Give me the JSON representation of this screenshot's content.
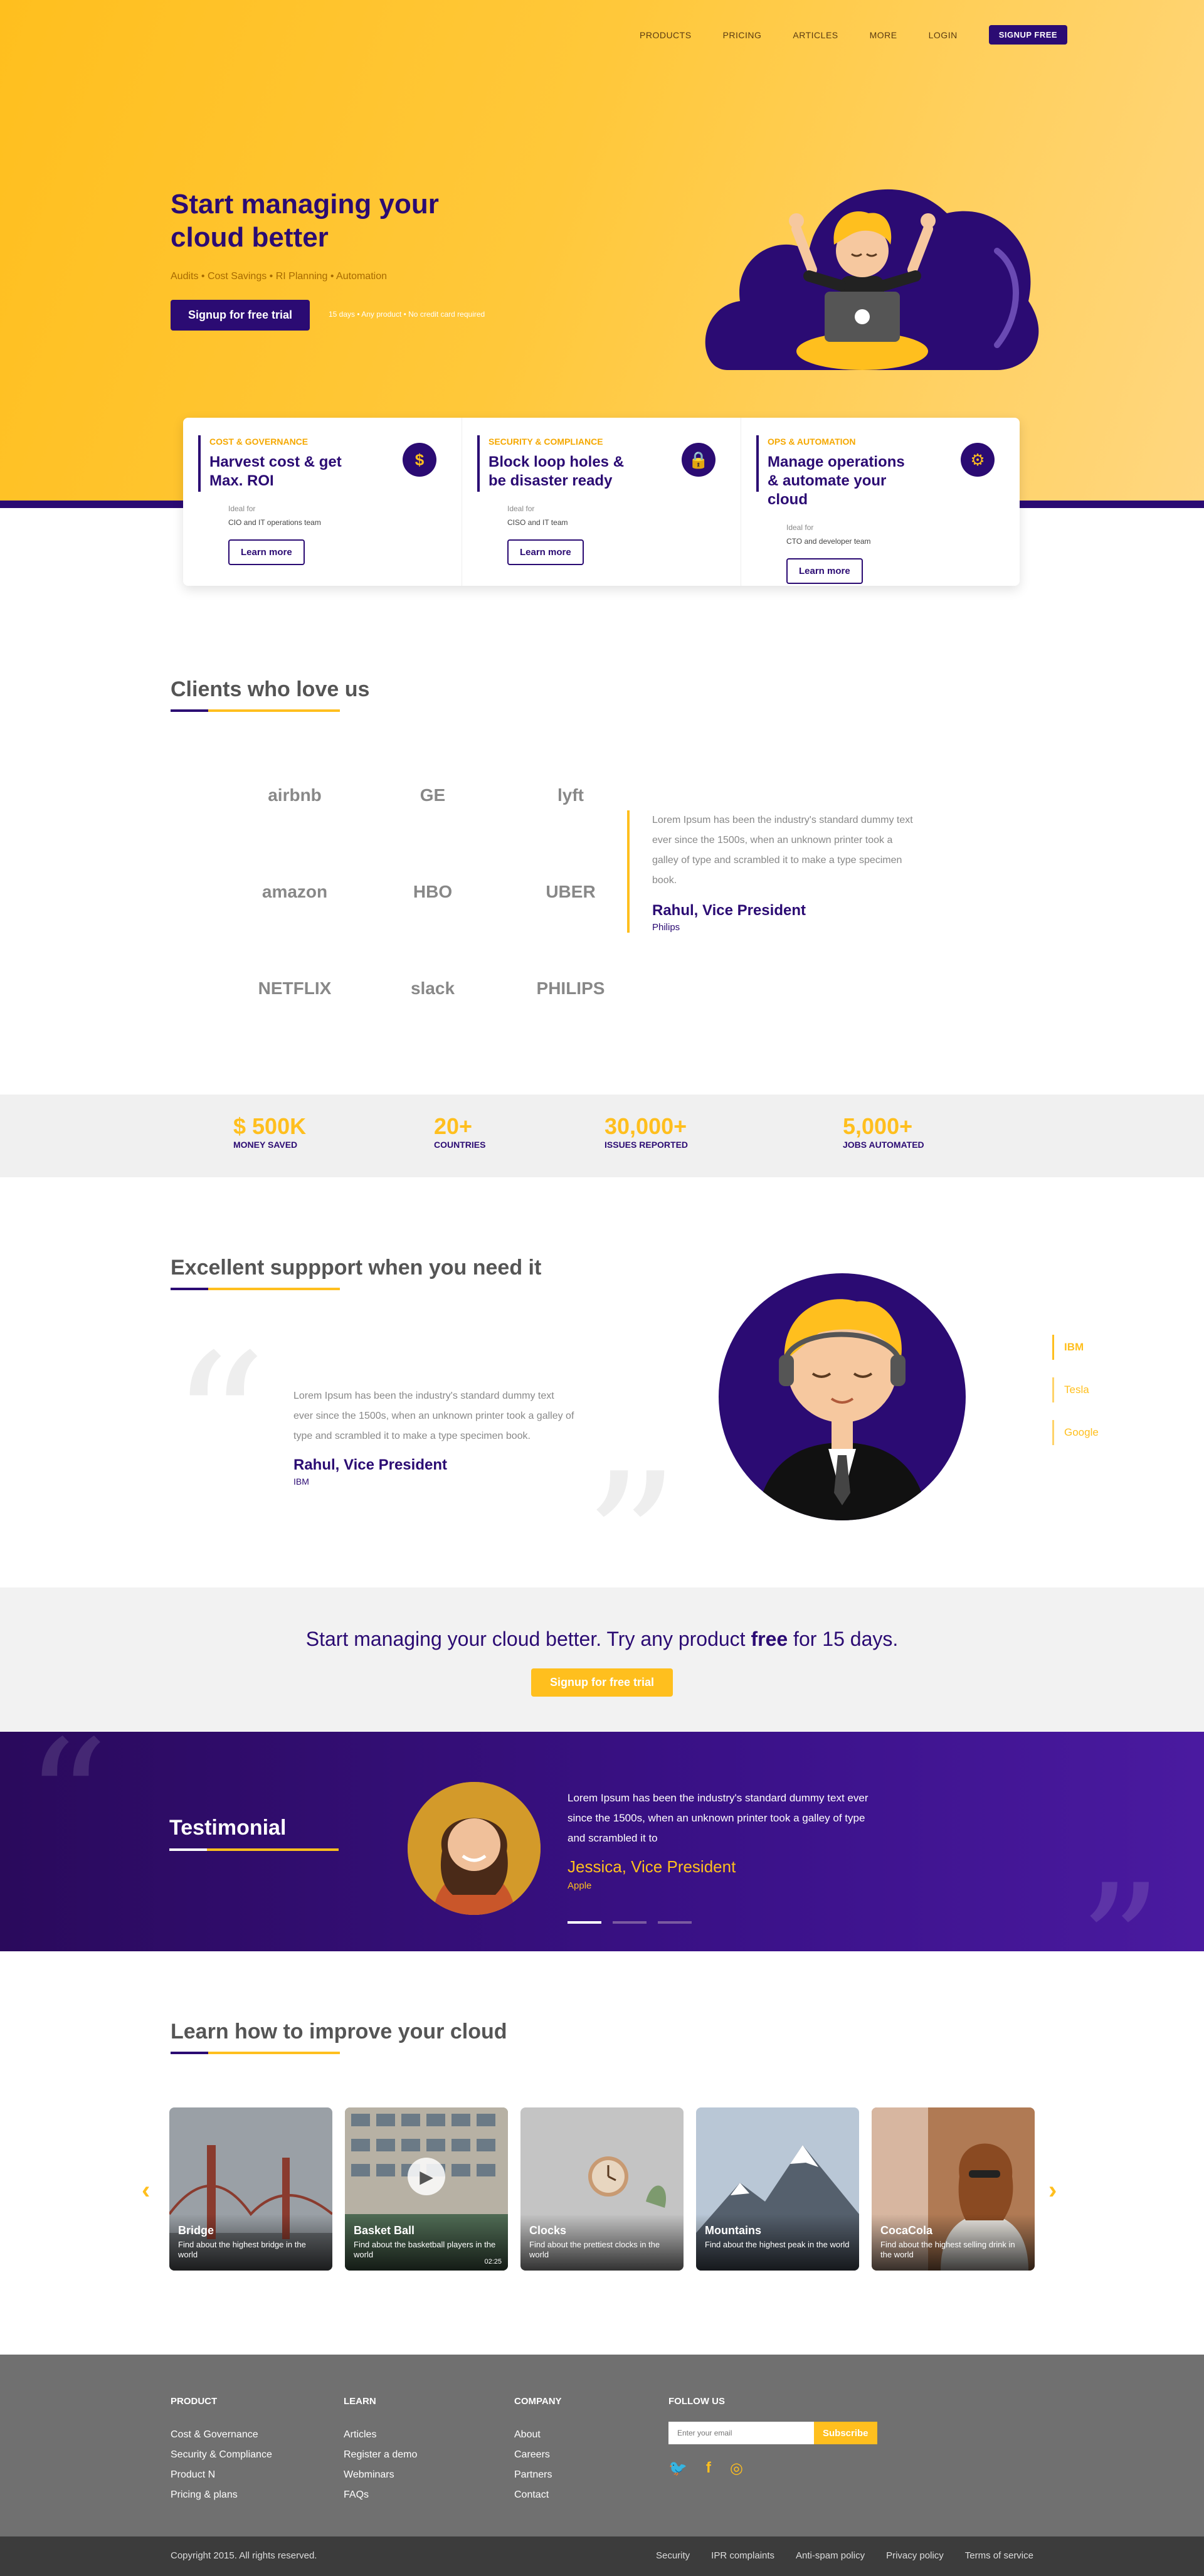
{
  "nav": {
    "items": [
      "PRODUCTS",
      "PRICING",
      "ARTICLES",
      "MORE",
      "LOGIN"
    ],
    "signup": "SIGNUP FREE"
  },
  "hero": {
    "title": "Start managing your cloud better",
    "tags": "Audits • Cost Savings • RI Planning • Automation",
    "cta": "Signup for free trial",
    "note": "15 days  •  Any product  •  No credit card required"
  },
  "cards": [
    {
      "category": "COST & GOVERNANCE",
      "title": "Harvest cost & get Max. ROI",
      "icon": "dollar-icon",
      "glyph": "$",
      "ideal": "Ideal for",
      "team": "CIO and IT operations team",
      "button": "Learn more"
    },
    {
      "category": "SECURITY & COMPLIANCE",
      "title": "Block loop holes & be disaster ready",
      "icon": "lock-icon",
      "glyph": "🔒",
      "ideal": "Ideal for",
      "team": "CISO and IT team",
      "button": "Learn more"
    },
    {
      "category": "OPS & AUTOMATION",
      "title": "Manage operations & automate your cloud",
      "icon": "gear-icon",
      "glyph": "⚙",
      "ideal": "Ideal for",
      "team": "CTO and developer team",
      "button": "Learn more"
    }
  ],
  "clients": {
    "title": "Clients who love us",
    "logos": [
      "airbnb",
      "GE",
      "lyft",
      "amazon",
      "HBO",
      "UBER",
      "NETFLIX",
      "slack",
      "PHILIPS"
    ],
    "quote": "Lorem Ipsum has been the industry's standard dummy text ever since the 1500s, when an unknown printer took a galley of type and scrambled it to make a type specimen book.",
    "name": "Rahul, Vice President",
    "company": "Philips"
  },
  "stats": [
    {
      "value": "$ 500K",
      "label": "MONEY SAVED"
    },
    {
      "value": "20+",
      "label": "COUNTRIES"
    },
    {
      "value": "30,000+",
      "label": "ISSUES REPORTED"
    },
    {
      "value": "5,000+",
      "label": "JOBS AUTOMATED"
    }
  ],
  "support": {
    "title": "Excellent suppport when you need it",
    "quote": "Lorem Ipsum has been the industry's standard dummy text ever since the 1500s, when an unknown printer took a galley of type and scrambled it to make a type specimen book.",
    "name": "Rahul, Vice President",
    "company": "IBM",
    "tabs": [
      "IBM",
      "Tesla",
      "Google"
    ]
  },
  "cta": {
    "text_before": "Start managing your cloud better. Try any product ",
    "text_bold": "free",
    "text_after": " for 15 days.",
    "button": "Signup for free trial"
  },
  "testimonial": {
    "title": "Testimonial",
    "quote": "Lorem Ipsum has been the industry's standard dummy text ever since the 1500s, when an unknown printer took a galley of type and scrambled it to",
    "name": "Jessica, Vice President",
    "company": "Apple"
  },
  "learn": {
    "title": "Learn how to improve your cloud",
    "cards": [
      {
        "title": "Bridge",
        "desc": "Find about the highest bridge in the world",
        "bg": "#9aa0a6"
      },
      {
        "title": "Basket Ball",
        "desc": "Find about the  basketball players in the world",
        "bg": "#8d9b94",
        "duration": "02:25"
      },
      {
        "title": "Clocks",
        "desc": "Find about the prettiest  clocks in the world",
        "bg": "#c4c4c4"
      },
      {
        "title": "Mountains",
        "desc": "Find about the highest peak in the world",
        "bg": "#b9c7d6"
      },
      {
        "title": "CocaCola",
        "desc": "Find about the highest selling drink in the world",
        "bg": "#b07a54"
      }
    ]
  },
  "footer": {
    "product": {
      "title": "PRODUCT",
      "links": [
        "Cost & Governance",
        "Security & Compliance",
        "Product N",
        "Pricing & plans"
      ]
    },
    "learn": {
      "title": "LEARN",
      "links": [
        "Articles",
        "Register a demo",
        "Webminars",
        "FAQs"
      ]
    },
    "company": {
      "title": "COMPANY",
      "links": [
        "About",
        "Careers",
        "Partners",
        "Contact"
      ]
    },
    "follow": {
      "title": "FOLLOW US",
      "placeholder": "Enter your email",
      "button": "Subscribe"
    },
    "copyright": "Copyright 2015. All rights reserved.",
    "bottom_links": [
      "Security",
      "IPR complaints",
      "Anti-spam policy",
      "Privacy policy",
      "Terms of service"
    ]
  }
}
